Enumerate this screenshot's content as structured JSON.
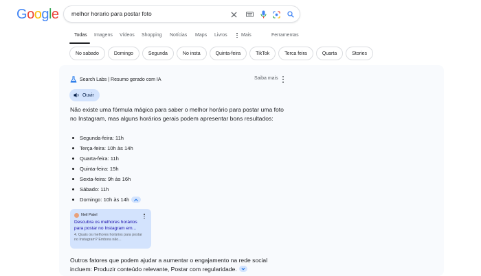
{
  "header": {
    "logo_letters": [
      "G",
      "o",
      "o",
      "g",
      "l",
      "e"
    ],
    "logo_colors": [
      "#4285f4",
      "#ea4335",
      "#fbbc05",
      "#4285f4",
      "#34a853",
      "#ea4335"
    ],
    "query": "melhor horario para postar foto",
    "icons": [
      "close-icon",
      "keyboard-icon",
      "microphone-icon",
      "lens-icon",
      "search-icon"
    ]
  },
  "tabs": [
    {
      "label": "Todas",
      "active": true
    },
    {
      "label": "Imagens"
    },
    {
      "label": "Vídeos"
    },
    {
      "label": "Shopping"
    },
    {
      "label": "Notícias"
    },
    {
      "label": "Maps"
    },
    {
      "label": "Livros"
    },
    {
      "label": "Mais"
    },
    {
      "label": "Ferramentas"
    }
  ],
  "chips": [
    "No sabado",
    "Domingo",
    "Segunda",
    "No insta",
    "Quinta-feira",
    "TikTok",
    "Terca feira",
    "Quarta",
    "Stories"
  ],
  "ai_overview": {
    "header_label": "Search Labs | Resumo gerado com IA",
    "saiba_mais": "Saiba mais",
    "listen_label": "Ouvir",
    "intro": "Não existe uma fórmula mágica para saber o melhor horário para postar uma foto no Instagram, mas alguns horários gerais podem apresentar bons resultados:",
    "schedule": [
      "Segunda-feira: 11h",
      "Terça-feira: 10h às 14h",
      "Quarta-feira: 11h",
      "Quinta-feira: 15h",
      "Sexta-feira: 9h às 16h",
      "Sábado: 11h",
      "Domingo: 10h às 14h"
    ],
    "source_card": {
      "source": "Neil Patel",
      "title": "Descubra os melhores horários para postar no Instagram em...",
      "snippet": "4. Quais os melhores horários para postar no Instagram? Embora não..."
    },
    "outro": "Outros fatores que podem ajudar a aumentar o engajamento na rede social incluem: Produzir conteúdo relevante, Postar com regularidade."
  }
}
